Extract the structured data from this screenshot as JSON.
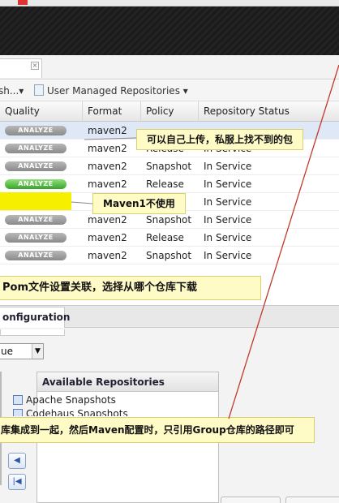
{
  "toolbar": {
    "left_label": "sh...▾",
    "user_managed_label": "User Managed Repositories ▾"
  },
  "tab": {
    "close": "×"
  },
  "table": {
    "headers": [
      "Quality",
      "Format",
      "Policy",
      "Repository Status"
    ],
    "rows": [
      {
        "quality": "ANALYZE",
        "badge": "gray",
        "format": "maven2",
        "policy": "",
        "status": ""
      },
      {
        "quality": "ANALYZE",
        "badge": "gray",
        "format": "maven2",
        "policy": "Release",
        "status": "In Service"
      },
      {
        "quality": "ANALYZE",
        "badge": "gray",
        "format": "maven2",
        "policy": "Snapshot",
        "status": "In Service"
      },
      {
        "quality": "ANALYZE",
        "badge": "green",
        "format": "maven2",
        "policy": "Release",
        "status": "In Service"
      },
      {
        "quality": "ANALYZE",
        "badge": "green",
        "format": "",
        "policy": "",
        "status": "In Service"
      },
      {
        "quality": "ANALYZE",
        "badge": "gray",
        "format": "maven2",
        "policy": "Snapshot",
        "status": "In Service"
      },
      {
        "quality": "ANALYZE",
        "badge": "gray",
        "format": "maven2",
        "policy": "Release",
        "status": "In Service"
      },
      {
        "quality": "ANALYZE",
        "badge": "gray",
        "format": "maven2",
        "policy": "Snapshot",
        "status": "In Service"
      }
    ]
  },
  "callouts": {
    "upload": "可以自己上传，私服上找不到的包",
    "maven1": "Maven1不使用",
    "pom": "Pom文件设置关联，选择从哪个仓库下载",
    "group": "库集成到一起，然后Maven配置时，只引用Group仓库的路径即可"
  },
  "config": {
    "tab_label": "onfiguration",
    "select_value": "ue",
    "available_title": "Available Repositories",
    "repos": [
      "Apache Snapshots",
      "Codehaus Snapshots"
    ]
  },
  "icons": {
    "select_arrow": "chevron-down-icon",
    "move_left": "arrow-left-icon",
    "move_first": "arrow-first-icon",
    "repo": "repository-icon"
  },
  "colors": {
    "highlight": "#f6f000",
    "callout_bg": "#fffbc6",
    "arrow": "#c0392b",
    "selected_row": "#dfe8f6"
  }
}
